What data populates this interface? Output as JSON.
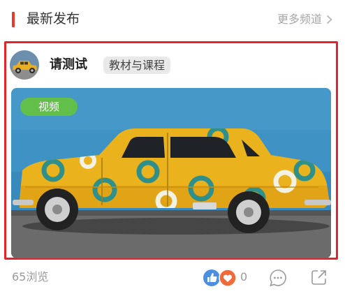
{
  "section": {
    "title": "最新发布",
    "more_label": "更多频道",
    "accent_color": "#e8392d"
  },
  "post": {
    "author_name": "请测试",
    "tag": "教材与课程",
    "avatar_icon": "yellow-car-avatar",
    "media": {
      "type": "video",
      "badge": "视频",
      "badge_color": "#62c04a",
      "subject": "yellow-vintage-car-with-teal-circles"
    },
    "highlight_color": "#e5232a",
    "stats": {
      "views": "65浏览",
      "likes": "0"
    }
  }
}
